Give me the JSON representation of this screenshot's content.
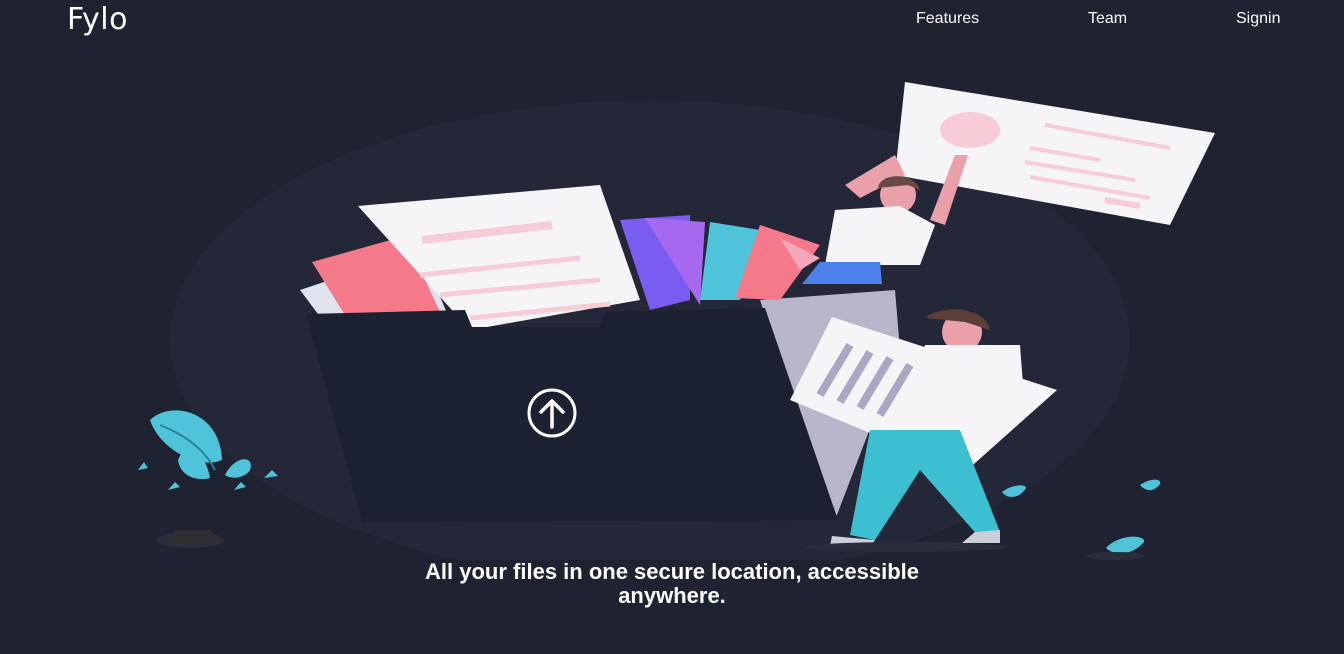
{
  "brand": {
    "logo_text": "Fylo"
  },
  "nav": {
    "items": [
      {
        "label": "Features"
      },
      {
        "label": "Team"
      },
      {
        "label": "Signin"
      }
    ]
  },
  "hero": {
    "tagline": "All your files in one secure location, accessible anywhere.",
    "illustration_icon": "upload-arrow-icon"
  },
  "colors": {
    "background": "#1f2230",
    "text": "#ffffff",
    "folder": "#1b2130",
    "folder_back": "#b9b6cc",
    "accent_teal": "#4fc3d9",
    "accent_pink": "#f4a7b9",
    "accent_purple": "#7b5cf0"
  }
}
